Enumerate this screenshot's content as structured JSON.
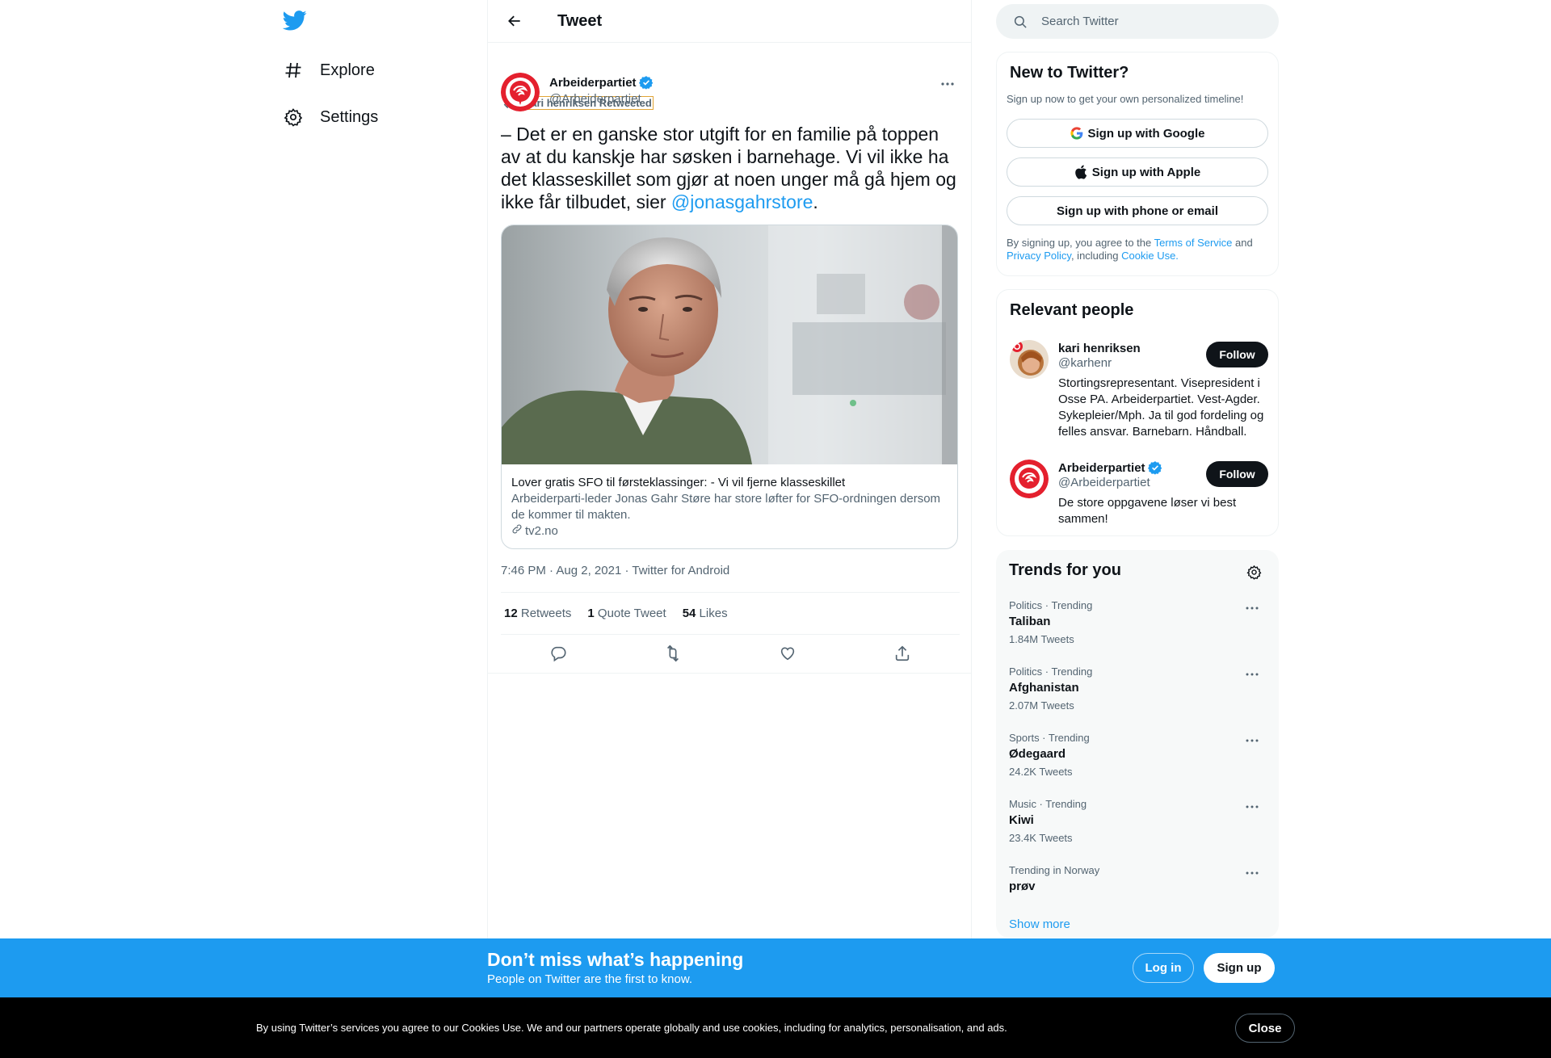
{
  "nav": {
    "items": [
      {
        "label": "Explore",
        "icon": "hashtag-icon"
      },
      {
        "label": "Settings",
        "icon": "gear-icon"
      }
    ]
  },
  "header": {
    "title": "Tweet"
  },
  "tweet": {
    "retweeted_by": "kari henriksen Retweeted",
    "author_name": "Arbeiderpartiet",
    "author_handle": "@Arbeiderpartiet",
    "text_before": "– Det er en ganske stor utgift for en familie på toppen av at du kanskje har søsken i barnehage. Vi vil ikke ha det klasseskillet som gjør at noen unger må gå hjem og ikke får tilbudet, sier ",
    "mention": "@jonasgahrstore",
    "text_after": ".",
    "card": {
      "title": "Lover gratis SFO til førsteklassinger: - Vi vil fjerne klasseskillet",
      "description": "Arbeiderparti-leder Jonas Gahr Støre har store løfter for SFO-ordningen dersom de kommer til makten.",
      "domain": "tv2.no"
    },
    "meta": {
      "time": "7:46 PM",
      "date": "Aug 2, 2021",
      "source": "Twitter for Android",
      "sep": " · "
    },
    "stats": {
      "retweets_count": "12",
      "retweets_label": "Retweets",
      "quotes_count": "1",
      "quotes_label": "Quote Tweet",
      "likes_count": "54",
      "likes_label": "Likes"
    }
  },
  "search": {
    "placeholder": "Search Twitter"
  },
  "new_to_twitter": {
    "title": "New to Twitter?",
    "subtitle": "Sign up now to get your own personalized timeline!",
    "google": "Sign up with Google",
    "apple": "Sign up with Apple",
    "phone": "Sign up with phone or email",
    "terms_1": "By signing up, you agree to the ",
    "terms_link": "Terms of Service",
    "terms_2": " and ",
    "privacy_link": "Privacy Policy",
    "terms_3": ", including ",
    "cookie_link": "Cookie Use."
  },
  "relevant": {
    "title": "Relevant people",
    "people": [
      {
        "name": "kari henriksen",
        "handle": "@karhenr",
        "bio": "Stortingsrepresentant. Visepresident i Osse PA. Arbeiderpartiet. Vest-Agder. Sykepleier/Mph. Ja til god fordeling og felles ansvar. Barnebarn. Håndball.",
        "follow": "Follow"
      },
      {
        "name": "Arbeiderpartiet",
        "handle": "@Arbeiderpartiet",
        "bio": "De store oppgavene løser vi best sammen!",
        "follow": "Follow"
      }
    ]
  },
  "trends": {
    "title": "Trends for you",
    "items": [
      {
        "context": "Politics · Trending",
        "name": "Taliban",
        "count": "1.84M Tweets"
      },
      {
        "context": "Politics · Trending",
        "name": "Afghanistan",
        "count": "2.07M Tweets"
      },
      {
        "context": "Sports · Trending",
        "name": "Ødegaard",
        "count": "24.2K Tweets"
      },
      {
        "context": "Music · Trending",
        "name": "Kiwi",
        "count": "23.4K Tweets"
      },
      {
        "context": "Trending in Norway",
        "name": "prøv",
        "count": ""
      }
    ],
    "show_more": "Show more"
  },
  "banner": {
    "title": "Don’t miss what’s happening",
    "subtitle": "People on Twitter are the first to know.",
    "login": "Log in",
    "signup": "Sign up"
  },
  "cookie": {
    "text": "By using Twitter’s services you agree to our Cookies Use. We and our partners operate globally and use cookies, including for analytics, personalisation, and ads.",
    "close": "Close"
  },
  "colors": {
    "accent": "#1d9bf0",
    "text": "#0f1419",
    "muted": "#536471",
    "party_red": "#e4202e"
  }
}
